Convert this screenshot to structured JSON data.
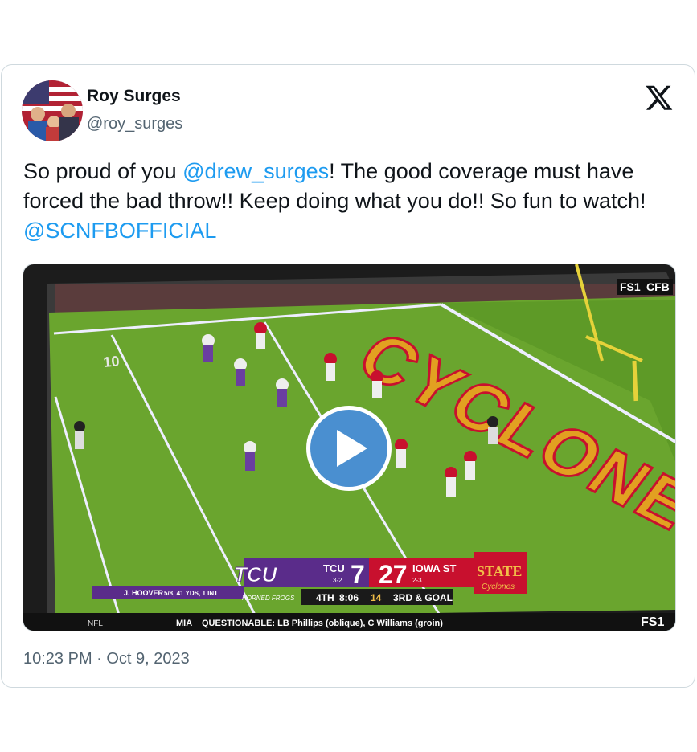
{
  "tweet": {
    "author_name": "Roy Surges",
    "author_handle": "@roy_surges",
    "text_part1": "So proud of you ",
    "mention1": "@drew_surges",
    "text_part2": "!  The good coverage must have forced the bad throw!!  Keep doing what you do!!  So fun to watch! ",
    "mention2": "@SCNFBOFFICIAL",
    "timestamp": "10:23 PM · Oct 9, 2023"
  },
  "video": {
    "network_top": "FS1",
    "network_top_sub": "CFB",
    "network_bottom": "FS1",
    "endzone_text": "CYCLONES",
    "yard_marker": "10",
    "ticker": "MIA    QUESTIONABLE: LB Phillips (oblique), C Williams (groin)",
    "ticker_left": "NFL",
    "player_stat_name": "J. HOOVER",
    "player_stat_line": "5/8, 41 YDS, 1 INT",
    "team1_logo": "TCU",
    "team1_logo_sub": "HORNED FROGS",
    "team1_abbr": "TCU",
    "team1_record": "3-2",
    "team1_score": "7",
    "team2_score": "27",
    "team2_abbr": "IOWA ST",
    "team2_record": "2-3",
    "team2_logo": "STATE",
    "team2_logo_sub": "Cyclones",
    "quarter": "4TH",
    "clock": "8:06",
    "play_clock": "14",
    "down": "3RD & GOAL",
    "colors": {
      "tcu": "#5a2c8a",
      "isu": "#c8102e",
      "field": "#6aa52e",
      "endzone": "#e2a021"
    }
  },
  "icons": {
    "logo": "x-logo-icon",
    "play": "play-icon"
  }
}
